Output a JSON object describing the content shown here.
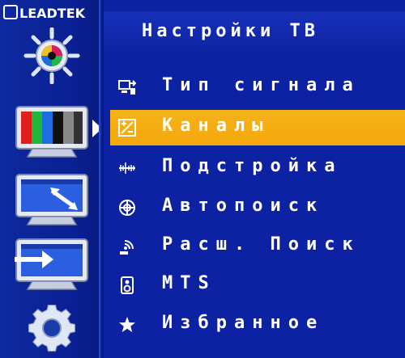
{
  "brand": {
    "logo_text": "LEADTEK"
  },
  "header": {
    "title": "Настройки ТВ"
  },
  "sidebar": {
    "items": [
      {
        "icon": "picture-settings-icon"
      },
      {
        "icon": "tv-color-bars-icon"
      },
      {
        "icon": "screen-resize-icon"
      },
      {
        "icon": "input-source-icon"
      },
      {
        "icon": "gear-icon"
      }
    ],
    "selected_index": 1
  },
  "menu": {
    "items": [
      {
        "label": "Тип сигнала",
        "icon": "signal-type-icon"
      },
      {
        "label": "Каналы",
        "icon": "channels-icon"
      },
      {
        "label": "Подстройка",
        "icon": "fine-tune-icon"
      },
      {
        "label": "Автопоиск",
        "icon": "auto-scan-icon"
      },
      {
        "label": "Расш. Поиск",
        "icon": "advanced-scan-icon"
      },
      {
        "label": "MTS",
        "icon": "mts-audio-icon"
      },
      {
        "label": "Избранное",
        "icon": "star-icon"
      }
    ],
    "selected_index": 1
  },
  "colors": {
    "highlight": "#f5a80a",
    "background": "#0d22a2",
    "text": "#ffffff"
  }
}
